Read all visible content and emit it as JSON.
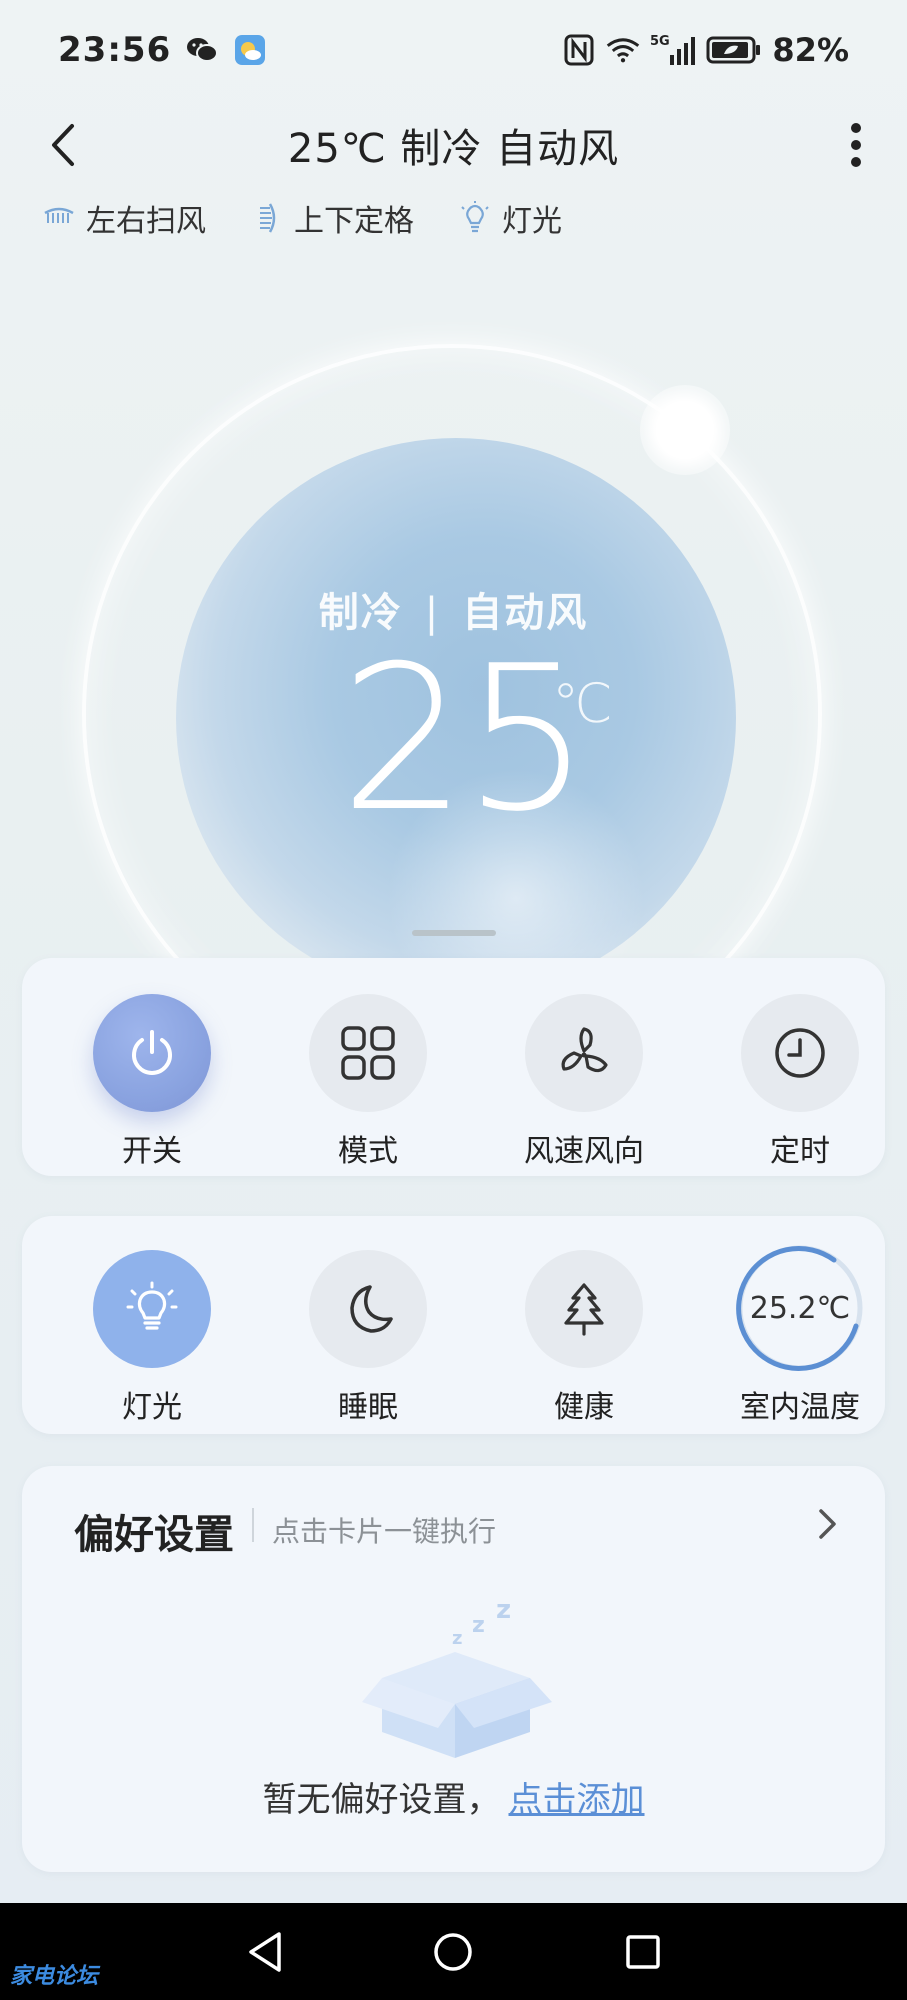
{
  "status_bar": {
    "time": "23:56",
    "battery": "82%",
    "network": "5G",
    "icons": [
      "wechat-icon",
      "weather-app-icon",
      "nfc-icon",
      "wifi-icon",
      "signal-icon",
      "battery-icon"
    ]
  },
  "header": {
    "title": "25℃ 制冷 自动风"
  },
  "feature_tags": [
    {
      "label": "左右扫风",
      "icon": "horizontal-swing-icon"
    },
    {
      "label": "上下定格",
      "icon": "vertical-fixed-icon"
    },
    {
      "label": "灯光",
      "icon": "light-bulb-icon"
    }
  ],
  "dial": {
    "mode": "制冷",
    "separator": "|",
    "fan": "自动风",
    "temperature": "25",
    "unit": "℃"
  },
  "controls": [
    {
      "label": "开关",
      "icon": "power-icon",
      "active": true
    },
    {
      "label": "模式",
      "icon": "mode-grid-icon",
      "active": false
    },
    {
      "label": "风速风向",
      "icon": "fan-icon",
      "active": false
    },
    {
      "label": "定时",
      "icon": "clock-icon",
      "active": false
    }
  ],
  "features": [
    {
      "label": "灯光",
      "icon": "light-bulb-icon",
      "active": true
    },
    {
      "label": "睡眠",
      "icon": "moon-icon",
      "active": false
    },
    {
      "label": "健康",
      "icon": "tree-icon",
      "active": false
    },
    {
      "label": "室内温度",
      "value": "25.2℃"
    }
  ],
  "prefs": {
    "title": "偏好设置",
    "subtitle": "点击卡片一键执行",
    "empty_text": "暂无偏好设置，",
    "add_link": "点击添加"
  },
  "nav": {
    "watermark": "家电论坛"
  },
  "colors": {
    "accent_active": "#8aa3e0",
    "accent_light": "#8fb2eb",
    "link": "#5b8fd6",
    "card_bg": "#f2f6fb"
  }
}
